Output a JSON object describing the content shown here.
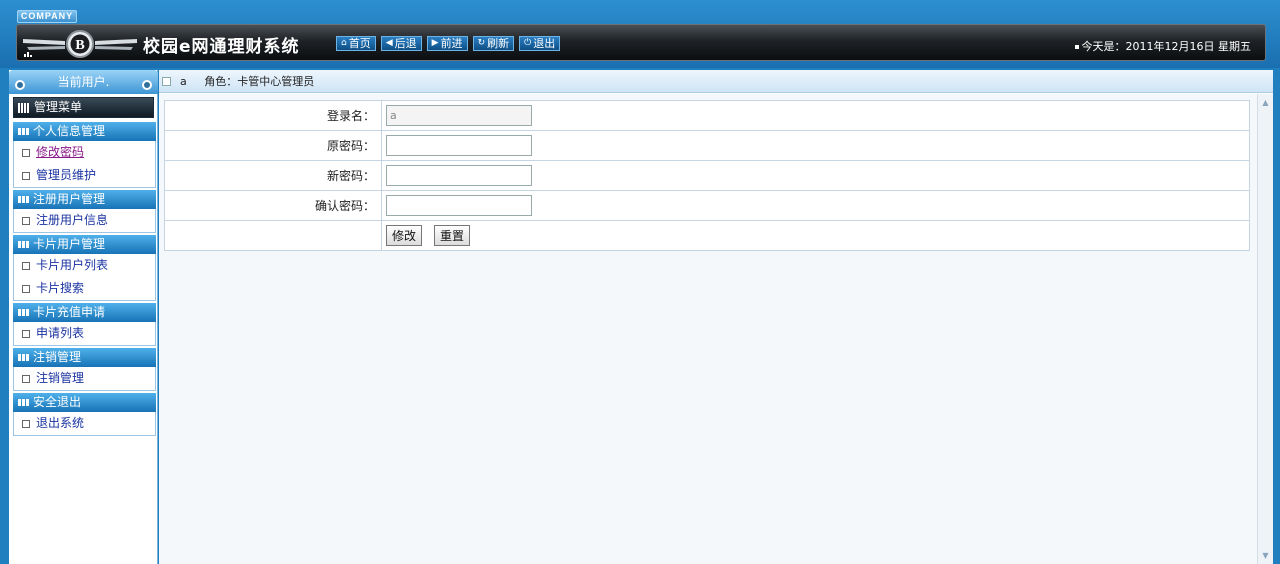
{
  "header": {
    "company_tag": "COMPANY",
    "title": "校园e网通理财系统",
    "nav": [
      {
        "icon": "home-icon",
        "glyph": "⌂",
        "label": "首页"
      },
      {
        "icon": "back-arrow-icon",
        "glyph": "◀",
        "label": "后退"
      },
      {
        "icon": "forward-arrow-icon",
        "glyph": "▶",
        "label": "前进"
      },
      {
        "icon": "refresh-icon",
        "glyph": "↻",
        "label": "刷新"
      },
      {
        "icon": "power-icon",
        "glyph": "⏻",
        "label": "退出"
      }
    ],
    "date_text": "今天是：2011年12月16日 星期五"
  },
  "sidebar": {
    "current_user_label": "当前用户.",
    "menu_header": "管理菜单",
    "groups": [
      {
        "title": "个人信息管理",
        "items": [
          "修改密码",
          "管理员维护"
        ]
      },
      {
        "title": "注册用户管理",
        "items": [
          "注册用户信息"
        ]
      },
      {
        "title": "卡片用户管理",
        "items": [
          "卡片用户列表",
          "卡片搜索"
        ]
      },
      {
        "title": "卡片充值申请",
        "items": [
          "申请列表"
        ]
      },
      {
        "title": "注销管理",
        "items": [
          "注销管理"
        ]
      },
      {
        "title": "安全退出",
        "items": [
          "退出系统"
        ]
      }
    ]
  },
  "main": {
    "user": "a",
    "role": "角色：卡管中心管理员",
    "form": {
      "login_label": "登录名：",
      "login_value": "a",
      "old_pwd_label": "原密码：",
      "new_pwd_label": "新密码：",
      "confirm_pwd_label": "确认密码：",
      "submit_label": "修改",
      "reset_label": "重置"
    }
  },
  "colors": {
    "accent": "#1f7fbf",
    "header_bar": "#1f2327",
    "group_title": "#1773b6",
    "visited_link": "#8a1a8a"
  }
}
